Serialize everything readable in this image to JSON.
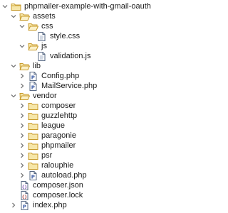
{
  "tree": {
    "root": {
      "label": "phpmailer-example-with-gmail-oauth",
      "icon": "project-folder-icon",
      "expanded": true
    },
    "assets": {
      "label": "assets",
      "icon": "folder-open-icon",
      "expanded": true
    },
    "css": {
      "label": "css",
      "icon": "folder-open-icon",
      "expanded": true
    },
    "style_css": {
      "label": "style.css",
      "icon": "css-file-icon"
    },
    "js": {
      "label": "js",
      "icon": "folder-open-icon",
      "expanded": true
    },
    "validation_js": {
      "label": "validation.js",
      "icon": "js-file-icon"
    },
    "lib": {
      "label": "lib",
      "icon": "folder-open-icon",
      "expanded": true
    },
    "config_php": {
      "label": "Config.php",
      "icon": "php-file-icon"
    },
    "mailservice_php": {
      "label": "MailService.php",
      "icon": "php-file-icon"
    },
    "vendor": {
      "label": "vendor",
      "icon": "folder-open-icon",
      "expanded": true
    },
    "composer": {
      "label": "composer",
      "icon": "folder-icon",
      "expanded": false
    },
    "guzzlehttp": {
      "label": "guzzlehttp",
      "icon": "folder-icon",
      "expanded": false
    },
    "league": {
      "label": "league",
      "icon": "folder-icon",
      "expanded": false
    },
    "paragonie": {
      "label": "paragonie",
      "icon": "folder-icon",
      "expanded": false
    },
    "phpmailer": {
      "label": "phpmailer",
      "icon": "folder-icon",
      "expanded": false
    },
    "psr": {
      "label": "psr",
      "icon": "folder-icon",
      "expanded": false
    },
    "ralouphie": {
      "label": "ralouphie",
      "icon": "folder-icon",
      "expanded": false
    },
    "autoload_php": {
      "label": "autoload.php",
      "icon": "php-file-icon"
    },
    "composer_json": {
      "label": "composer.json",
      "icon": "json-file-icon"
    },
    "composer_lock": {
      "label": "composer.lock",
      "icon": "lock-file-icon"
    },
    "index_php": {
      "label": "index.php",
      "icon": "php-file-icon"
    }
  },
  "colors": {
    "text": "#1a1a1a",
    "twisty": "#7a7a7a",
    "folder_fill": "#f6e6a8",
    "folder_stroke": "#c89b2c",
    "file_stroke": "#5a6b86",
    "php_accent": "#3f5fa8",
    "json_accent": "#7a4fb3",
    "lock_accent": "#a33a3a"
  }
}
